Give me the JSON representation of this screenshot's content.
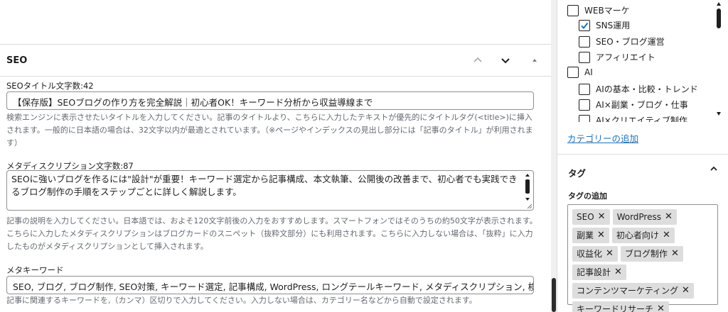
{
  "seo": {
    "title": "SEO",
    "seo_title_label": "SEOタイトル文字数:42",
    "seo_title_value": "【保存版】SEOブログの作り方を完全解説｜初心者OK！キーワード分析から収益導線まで",
    "seo_title_help": "検索エンジンに表示させたいタイトルを入力してください。記事のタイトルより、こちらに入力したテキストが優先的にタイトルタグ(<title>)に挿入されます。一般的に日本語の場合は、32文字以内が最適とされています。（※ページやインデックスの見出し部分には「記事のタイトル」が利用されます）",
    "meta_desc_label": "メタディスクリプション文字数:87",
    "meta_desc_value": "SEOに強いブログを作るには\"設計\"が重要！キーワード選定から記事構成、本文執筆、公開後の改善まで、初心者でも実践できるブログ制作の手順をステップごとに詳しく解説します。",
    "meta_desc_help": "記事の説明を入力してください。日本語では、およそ120文字前後の入力をおすすめします。スマートフォンではそのうちの約50文字が表示されます。こちらに入力したメタディスクリプションはブログカードのスニペット（抜粋文部分）にも利用されます。こちらに入力しない場合は、「抜粋」に入力したものがメタディスクリプションとして挿入されます。",
    "meta_kw_label": "メタキーワード",
    "meta_kw_value": "SEO, ブログ, ブログ制作, SEO対策, キーワード選定, 記事構成, WordPress, ロングテールキーワード, メタディスクリプション, 検",
    "meta_kw_help": "記事に関連するキーワードを,（カンマ）区切りで入力してください。入力しない場合は、カテゴリー名などから自動で設定されます。"
  },
  "categories": {
    "items": [
      {
        "label": "WEBマーケ",
        "checked": false
      },
      {
        "label": "SNS運用",
        "checked": true
      },
      {
        "label": "SEO・ブログ運営",
        "checked": false
      },
      {
        "label": "アフィリエイト",
        "checked": false
      },
      {
        "label": "AI",
        "checked": false
      },
      {
        "label": "AIの基本・比較・トレンド",
        "checked": false
      },
      {
        "label": "AI×副業・ブログ・仕事",
        "checked": false
      },
      {
        "label": "AI×クリエイティブ制作",
        "checked": false
      }
    ],
    "add_link": "カテゴリーの追加"
  },
  "tags": {
    "title": "タグ",
    "add_label": "タグの追加",
    "items": [
      "SEO",
      "WordPress",
      "副業",
      "初心者向け",
      "収益化",
      "ブログ制作",
      "記事設計",
      "コンテンツマーケティング",
      "キーワードリサーチ"
    ],
    "remove_glyph": "✕"
  },
  "colors": {
    "link": "#2271b1",
    "check": "#2271b1",
    "border": "#8c8f94",
    "help": "#646970"
  }
}
